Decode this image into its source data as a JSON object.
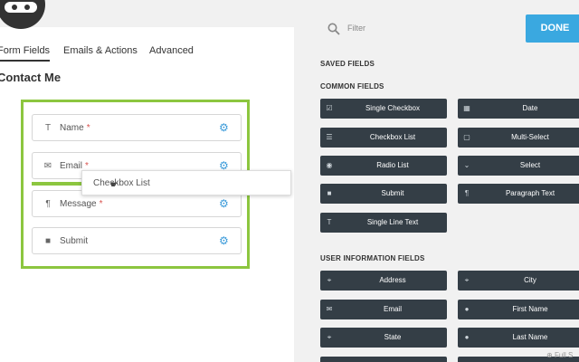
{
  "builder": {
    "tabs": [
      {
        "label": "Form Fields",
        "active": true
      },
      {
        "label": "Emails & Actions",
        "active": false
      },
      {
        "label": "Advanced",
        "active": false
      }
    ],
    "form_title": "Contact Me",
    "fields": [
      {
        "label": "Name",
        "required": "*",
        "icon": "text-icon"
      },
      {
        "label": "Email",
        "required": "*",
        "icon": "envelope-icon"
      },
      {
        "label": "Message",
        "required": "*",
        "icon": "paragraph-icon"
      },
      {
        "label": "Submit",
        "required": "",
        "icon": "square-icon"
      }
    ],
    "drag_ghost_label": "Checkbox List"
  },
  "panel": {
    "filter_placeholder": "Filter",
    "done_label": "DONE",
    "saved_fields_title": "SAVED FIELDS",
    "common_fields_title": "COMMON FIELDS",
    "common_fields": [
      {
        "label": "Single Checkbox",
        "icon": "checkbox-icon"
      },
      {
        "label": "Date",
        "icon": "calendar-icon"
      },
      {
        "label": "Checkbox List",
        "icon": "list-icon"
      },
      {
        "label": "Multi-Select",
        "icon": "square-outline-icon"
      },
      {
        "label": "Radio List",
        "icon": "radio-icon"
      },
      {
        "label": "Select",
        "icon": "chevron-down-icon"
      },
      {
        "label": "Submit",
        "icon": "square-icon"
      },
      {
        "label": "Paragraph Text",
        "icon": "paragraph-icon"
      },
      {
        "label": "Single Line Text",
        "icon": "text-icon"
      }
    ],
    "user_info_title": "USER INFORMATION FIELDS",
    "user_info_fields": [
      {
        "label": "Address",
        "icon": "map-pin-icon"
      },
      {
        "label": "City",
        "icon": "map-pin-icon"
      },
      {
        "label": "Email",
        "icon": "envelope-icon"
      },
      {
        "label": "First Name",
        "icon": "user-icon"
      },
      {
        "label": "State",
        "icon": "map-pin-icon"
      },
      {
        "label": "Last Name",
        "icon": "user-icon"
      }
    ],
    "fullscreen_label": "Full S"
  },
  "colors": {
    "accent_green": "#8cc63f",
    "done_blue": "#3aa8e0",
    "tile_dark": "#343e46",
    "required_red": "#d9534f",
    "gear_blue": "#3a9ad9"
  }
}
